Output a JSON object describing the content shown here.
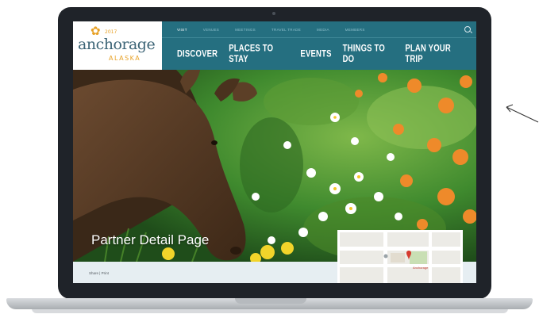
{
  "site": {
    "logo": {
      "year": "2017",
      "main": "anchorage",
      "sub": "ALASKA"
    },
    "utility_nav": [
      "VISIT",
      "VENUES",
      "MEETINGS",
      "TRAVEL TRADE",
      "MEDIA",
      "MEMBERS"
    ],
    "main_nav": [
      "DISCOVER",
      "PLACES TO STAY",
      "EVENTS",
      "THINGS TO DO",
      "PLAN YOUR TRIP"
    ],
    "hero_title": "Partner Detail Page",
    "share_text": "Share | Print",
    "map_label": "Anchorage"
  },
  "colors": {
    "nav_bg": "#256f80",
    "logo_blue": "#3c6476",
    "logo_gold": "#e7a126",
    "bezel": "#1f2329"
  },
  "icons": [
    "flower-logo-icon",
    "search-icon",
    "map-pin-icon",
    "sketch-arrow-icon"
  ]
}
